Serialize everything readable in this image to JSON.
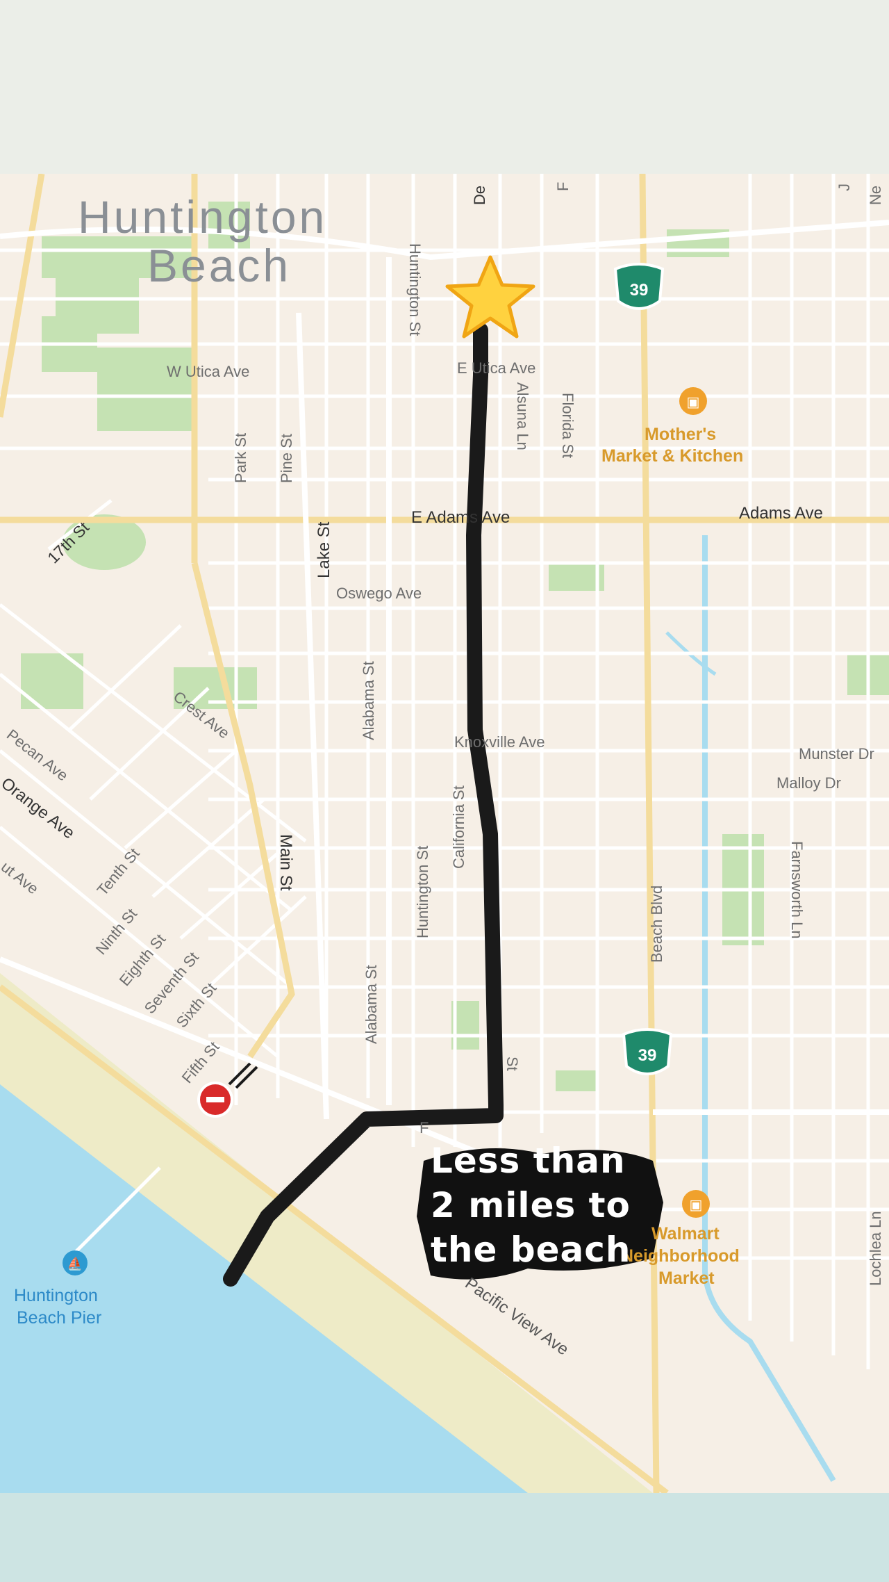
{
  "map": {
    "city_label_line1": "Huntington",
    "city_label_line2": "Beach",
    "streets": {
      "w_utica": "W Utica Ave",
      "e_utica": "E Utica Ave",
      "e_adams": "E Adams Ave",
      "adams": "Adams Ave",
      "oswego": "Oswego Ave",
      "knoxville": "Knoxville Ave",
      "munster": "Munster Dr",
      "malloy": "Malloy Dr",
      "seventeenth": "17th St",
      "crest": "Crest Ave",
      "pecan": "Pecan Ave",
      "orange": "Orange Ave",
      "walnut": "ut Ave",
      "tenth": "Tenth St",
      "ninth": "Ninth St",
      "eighth": "Eighth St",
      "seventh": "Seventh St",
      "sixth": "Sixth St",
      "fifth": "Fifth St",
      "main": "Main St",
      "lake": "Lake St",
      "alabama_n": "Alabama St",
      "alabama_s": "Alabama St",
      "huntington_n": "Huntington St",
      "huntington_s": "Huntington St",
      "california": "California St",
      "alsuna": "Alsuna Ln",
      "florida": "Florida St",
      "park": "Park St",
      "pine": "Pine St",
      "beach_blvd": "Beach Blvd",
      "farnsworth": "Farnsworth Ln",
      "lochlea": "Lochlea Ln",
      "pacific_view": "Pacific View Ave",
      "delaware_partial": "De",
      "top_partial_f": "F",
      "top_partial_j": "J",
      "top_partial_ne": "Ne",
      "st_partial": "St",
      "f_partial": "F"
    },
    "route_shield": "39",
    "pois": {
      "mothers_line1": "Mother's",
      "mothers_line2": "Market & Kitchen",
      "walmart_line1": "Walmart",
      "walmart_line2": "Neighborhood",
      "walmart_line3": "Market",
      "pier_line1": "Huntington",
      "pier_line2": "Beach Pier"
    },
    "colors": {
      "land": "#f6efe6",
      "water": "#a8dcef",
      "sand": "#eeebc7",
      "park": "#c5e2b3",
      "road_minor": "#ffffff",
      "road_major": "#f4dc9c",
      "route_line": "#1a1a1a",
      "shield": "#1f8a6b",
      "poi_text": "#d89a2b"
    },
    "markers": {
      "destination": "star-emoji",
      "no_entry": "no-entry-icon"
    }
  },
  "caption": {
    "text": "Less than\n2 miles to\nthe beach"
  }
}
